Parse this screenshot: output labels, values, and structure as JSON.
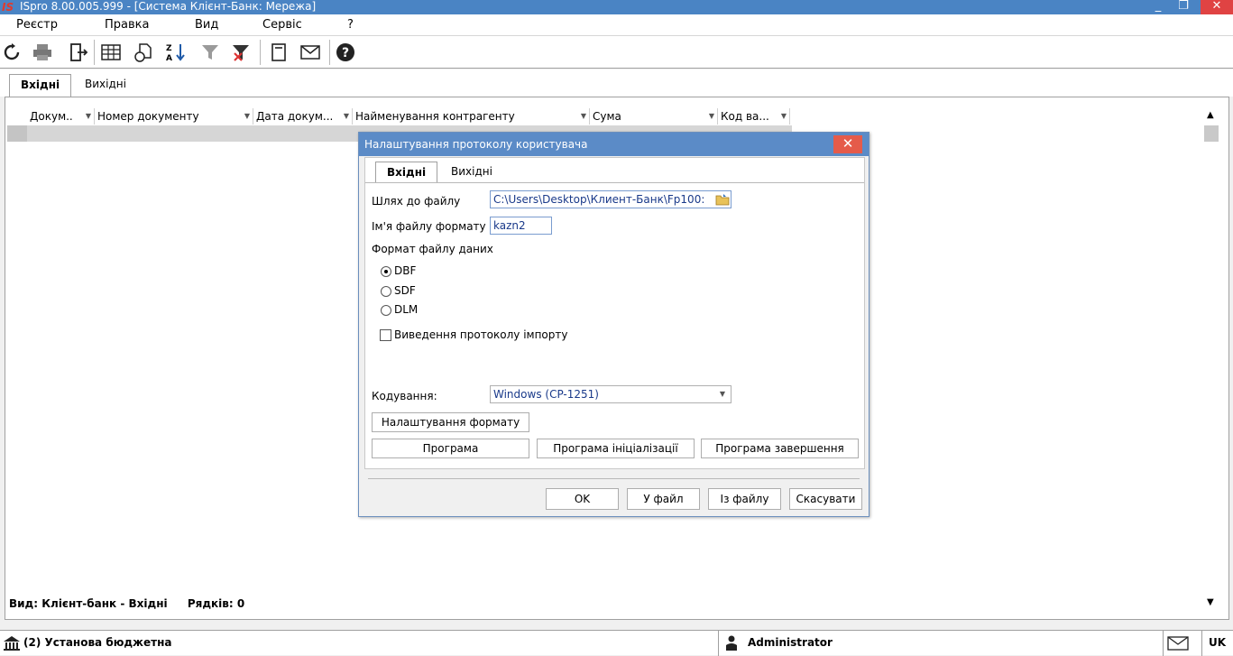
{
  "window": {
    "title": "ISpro 8.00.005.999 - [Система Клієнт-Банк: Мережа]",
    "logo": "IS",
    "minimize_icon": "_",
    "restore_icon": "❐",
    "close_icon": "✕"
  },
  "menu": [
    "Реєстр",
    "Правка",
    "Вид",
    "Сервіс",
    "?"
  ],
  "toolbar": {
    "icons": [
      "refresh-icon",
      "print-icon",
      "exit-icon",
      "table-icon",
      "copy-icon",
      "sort-icon",
      "filter-icon",
      "clear-filter-icon",
      "document-icon",
      "mail-icon",
      "help-icon"
    ]
  },
  "tabs": [
    "Вхідні",
    "Вихідні"
  ],
  "grid": {
    "columns": [
      "Докум..",
      "Номер документу",
      "Дата докум...",
      "Найменування контрагенту",
      "Сума",
      "Код ва..."
    ],
    "rows": []
  },
  "footer": {
    "view_label": "Вид: Клієнт-банк - Вхідні",
    "rows_label": "Рядків: 0"
  },
  "status": {
    "org": "(2) Установа бюджетна",
    "user": "Administrator",
    "lang": "UK"
  },
  "dialog": {
    "title": "Налаштування протоколу користувача",
    "close_icon": "✕",
    "tabs": [
      "Вхідні",
      "Вихідні"
    ],
    "path_label": "Шлях до файлу",
    "path_value": "C:\\Users\\Desktop\\Клиент-Банк\\Fp100:",
    "format_name_label": "Ім'я файлу формату",
    "format_name_value": "kazn2",
    "data_format_label": "Формат файлу даних",
    "formats": [
      {
        "label": "DBF",
        "selected": true
      },
      {
        "label": "SDF",
        "selected": false
      },
      {
        "label": "DLM",
        "selected": false
      }
    ],
    "import_log_label": "Виведення протоколу імпорту",
    "import_log_checked": false,
    "encoding_label": "Кодування:",
    "encoding_value": "Windows (CP-1251)",
    "format_settings_button": "Налаштування формату",
    "program_button": "Програма",
    "init_program_button": "Програма ініціалізації",
    "finish_program_button": "Програма завершення",
    "ok_button": "OK",
    "to_file_button": "У файл",
    "from_file_button": "Із файлу",
    "cancel_button": "Скасувати"
  }
}
